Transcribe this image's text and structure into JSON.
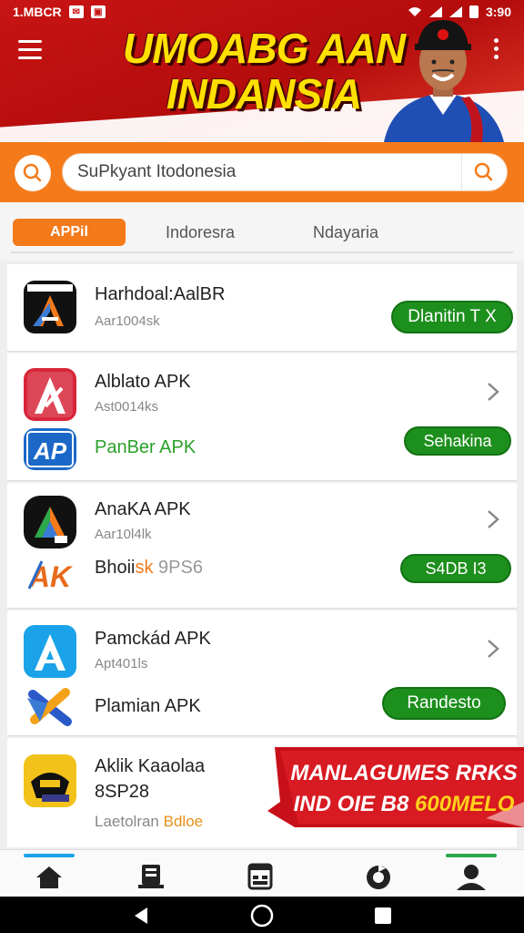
{
  "status_bar": {
    "left_text": "1.MBCR",
    "icons": [
      "message-icon",
      "notification-icon"
    ],
    "right_icons": [
      "wifi-icon",
      "signal-icon",
      "signal-icon",
      "battery-icon"
    ],
    "time": "3:90"
  },
  "banner": {
    "title_line1": "UMOABG AAN",
    "title_line2": "INDANSIA"
  },
  "search": {
    "value": "SuPkyant Itodonesia"
  },
  "tabs": [
    {
      "label": "APPil",
      "active": true
    },
    {
      "label": "Indoresra",
      "active": false
    },
    {
      "label": "Ndayaria",
      "active": false
    }
  ],
  "apps": [
    {
      "name": "Harhdoal:AalBR",
      "sub": "Aar1004sk",
      "button": "Dlanitin T X"
    },
    {
      "name": "Alblato APK",
      "sub": "Ast0014ks",
      "sub_app": "PanBer APK",
      "button": "Sehakina"
    },
    {
      "name": "AnaKA APK",
      "sub": "Aar10l4lk",
      "sub_app_prefix": "Bhoii",
      "sub_app_mid": "sk",
      "sub_app_suffix": "9PS6",
      "button": "S4DB I3"
    },
    {
      "name": "Pamckád APK",
      "sub": "Apt401ls",
      "sub_app": "Plamian APK",
      "button": "Randesto"
    },
    {
      "name": "Aklik Kaaolaa",
      "sub_line2": "8SP28",
      "footer_prefix": "Laetolran",
      "footer_accent": "Bdloe"
    }
  ],
  "promo": {
    "line1": "MANLAGUMES RRKS",
    "line2_prefix": "IND OIE B8",
    "line2_accent": "600MELO"
  },
  "bottom_nav": [
    "home-icon",
    "library-icon",
    "calendar-icon",
    "refresh-icon",
    "profile-icon"
  ],
  "colors": {
    "brand_red": "#c81414",
    "accent_orange": "#f47a1a",
    "button_green": "#1d8f1d",
    "title_yellow": "#ffe000"
  }
}
